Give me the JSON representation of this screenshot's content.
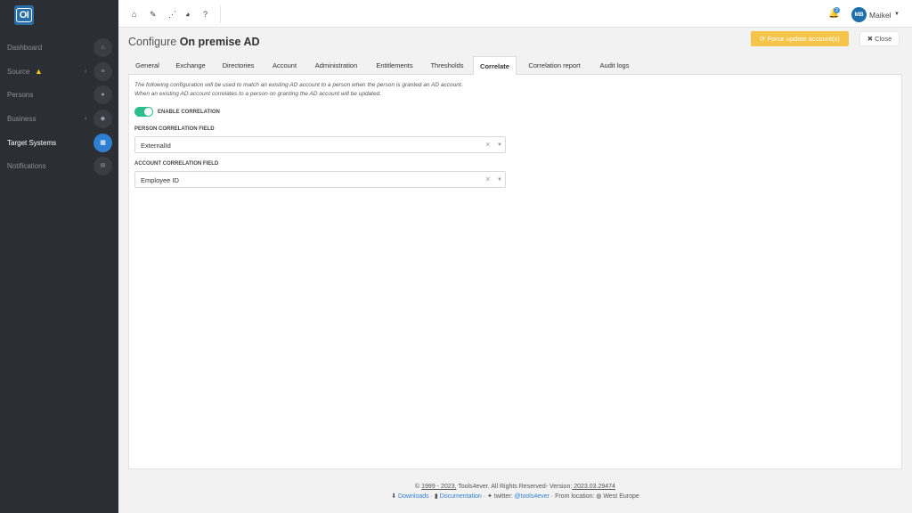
{
  "app": {
    "logo_text": "OI"
  },
  "sidebar": {
    "items": [
      {
        "label": "Dashboard",
        "icon": "home-icon",
        "glyph": "⌂"
      },
      {
        "label": "Source",
        "icon": "database-icon",
        "glyph": "≡",
        "has_warning": true,
        "has_chevron": true
      },
      {
        "label": "Persons",
        "icon": "users-icon",
        "glyph": "●"
      },
      {
        "label": "Business",
        "icon": "briefcase-icon",
        "glyph": "◆",
        "has_chevron": true
      },
      {
        "label": "Target Systems",
        "icon": "grid-icon",
        "glyph": "▦",
        "active": true
      },
      {
        "label": "Notifications",
        "icon": "envelope-icon",
        "glyph": "✉"
      }
    ]
  },
  "topbar": {
    "icons": [
      "home-icon",
      "wrench-icon",
      "share-icon",
      "pie-chart-icon",
      "help-icon"
    ],
    "notification_count": "2",
    "user_initials": "MB",
    "user_name": "Maikel"
  },
  "header": {
    "title_prefix": "Configure",
    "title_name": "On premise AD",
    "force_update_label": "⟳ Force update account(s)",
    "close_label": "✖ Close"
  },
  "tabs": [
    {
      "label": "General"
    },
    {
      "label": "Exchange"
    },
    {
      "label": "Directories"
    },
    {
      "label": "Account"
    },
    {
      "label": "Administration"
    },
    {
      "label": "Entitlements"
    },
    {
      "label": "Thresholds"
    },
    {
      "label": "Correlate",
      "active": true
    },
    {
      "label": "Correlation report"
    },
    {
      "label": "Audit logs"
    }
  ],
  "correlate": {
    "description_line1": "The following configuration will be used to match an existing AD account to a person when the person is granted an AD account.",
    "description_line2": "When an existing AD account correlates to a person on granting the AD account will be updated.",
    "enable_label": "ENABLE CORRELATION",
    "enabled": true,
    "person_field_label": "PERSON CORRELATION FIELD",
    "person_field_value": "ExternalId",
    "account_field_label": "ACCOUNT CORRELATION FIELD",
    "account_field_value": "Employee ID"
  },
  "footer": {
    "copyright_prefix": "© ",
    "years": "1999 - 2023,",
    "company_rights": " Tools4ever. All Rights Reserved- Version:",
    "version": " 2023.03.29474",
    "downloads": "Downloads",
    "documentation": "Documentation",
    "twitter_prefix": "twitter: ",
    "twitter_handle": "@tools4ever",
    "location": "From location: ",
    "region": "West Europe"
  }
}
